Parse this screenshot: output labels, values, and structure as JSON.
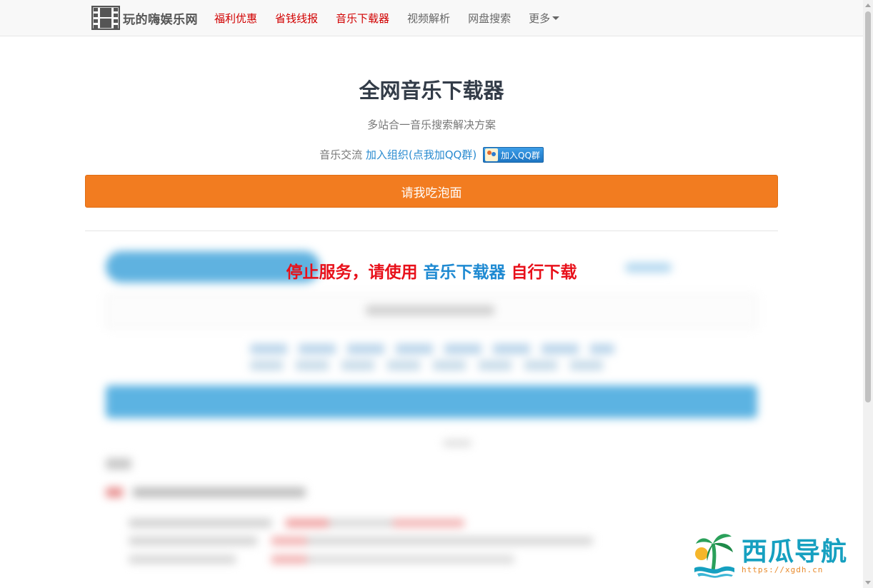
{
  "navbar": {
    "brand": "玩的嗨娱乐网",
    "links": [
      {
        "label": "福利优惠"
      },
      {
        "label": "省钱线报"
      },
      {
        "label": "音乐下载器"
      },
      {
        "label": "视频解析"
      },
      {
        "label": "网盘搜索"
      },
      {
        "label": "更多"
      }
    ],
    "active_color": "#d10000"
  },
  "header": {
    "title": "全网音乐下载器",
    "subtitle": "多站合一音乐搜索解决方案",
    "qq_prefix": "音乐交流",
    "qq_link": "加入组织(点我加QQ群)",
    "qq_badge": "加入QQ群"
  },
  "donate_button": {
    "label": "请我吃泡面",
    "color": "#f27c20"
  },
  "notice": {
    "part1": "停止服务，请使用",
    "link": "音乐下载器",
    "part2": "自行下载",
    "color": "#e8101a",
    "link_color": "#1f8ad2"
  },
  "watermark": {
    "text": "西瓜导航",
    "url": "https://xgdh.cn"
  }
}
